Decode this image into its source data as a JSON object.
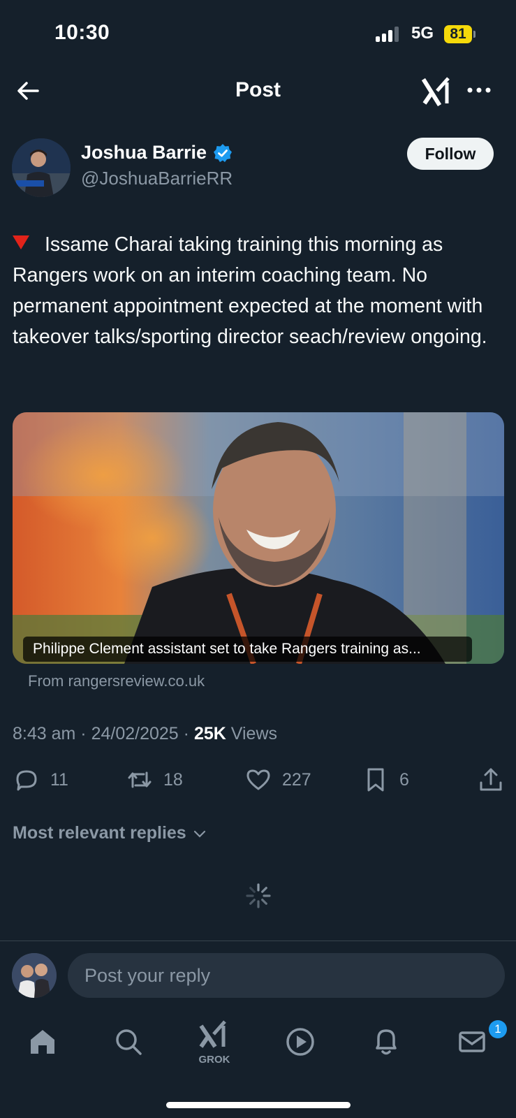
{
  "status_bar": {
    "time": "10:30",
    "network": "5G",
    "battery": "81"
  },
  "header": {
    "title": "Post"
  },
  "author": {
    "name": "Joshua Barrie",
    "handle": "@JoshuaBarrieRR",
    "verified": true,
    "follow_label": "Follow",
    "avatar_lettering": "Joshua Barrie"
  },
  "tweet": {
    "text": "Issame Charai taking training this morning as Rangers work on an interim coaching team. No permanent appointment expected at the moment with takeover talks/sporting director seach/review ongoing.",
    "bullet_icon": "red-down-triangle-icon"
  },
  "card": {
    "caption": "Philippe Clement assistant set to take Rangers training as...",
    "source": "From rangersreview.co.uk"
  },
  "meta": {
    "time": "8:43 am",
    "date": "24/02/2025",
    "views_count": "25K",
    "views_label": "Views",
    "separator": "·"
  },
  "actions": {
    "replies": "11",
    "reposts": "18",
    "likes": "227",
    "bookmarks": "6"
  },
  "replies_sort": {
    "label": "Most relevant replies"
  },
  "reply_bar": {
    "placeholder": "Post your reply"
  },
  "tab_bar": {
    "grok_label": "GROK",
    "messages_badge": "1",
    "items": [
      "home-icon",
      "search-icon",
      "grok-icon",
      "video-icon",
      "bell-icon",
      "mail-icon"
    ]
  },
  "colors": {
    "background": "#15202b",
    "muted": "#8b98a5",
    "accent": "#1d9bf0",
    "battery": "#f5d90a"
  }
}
